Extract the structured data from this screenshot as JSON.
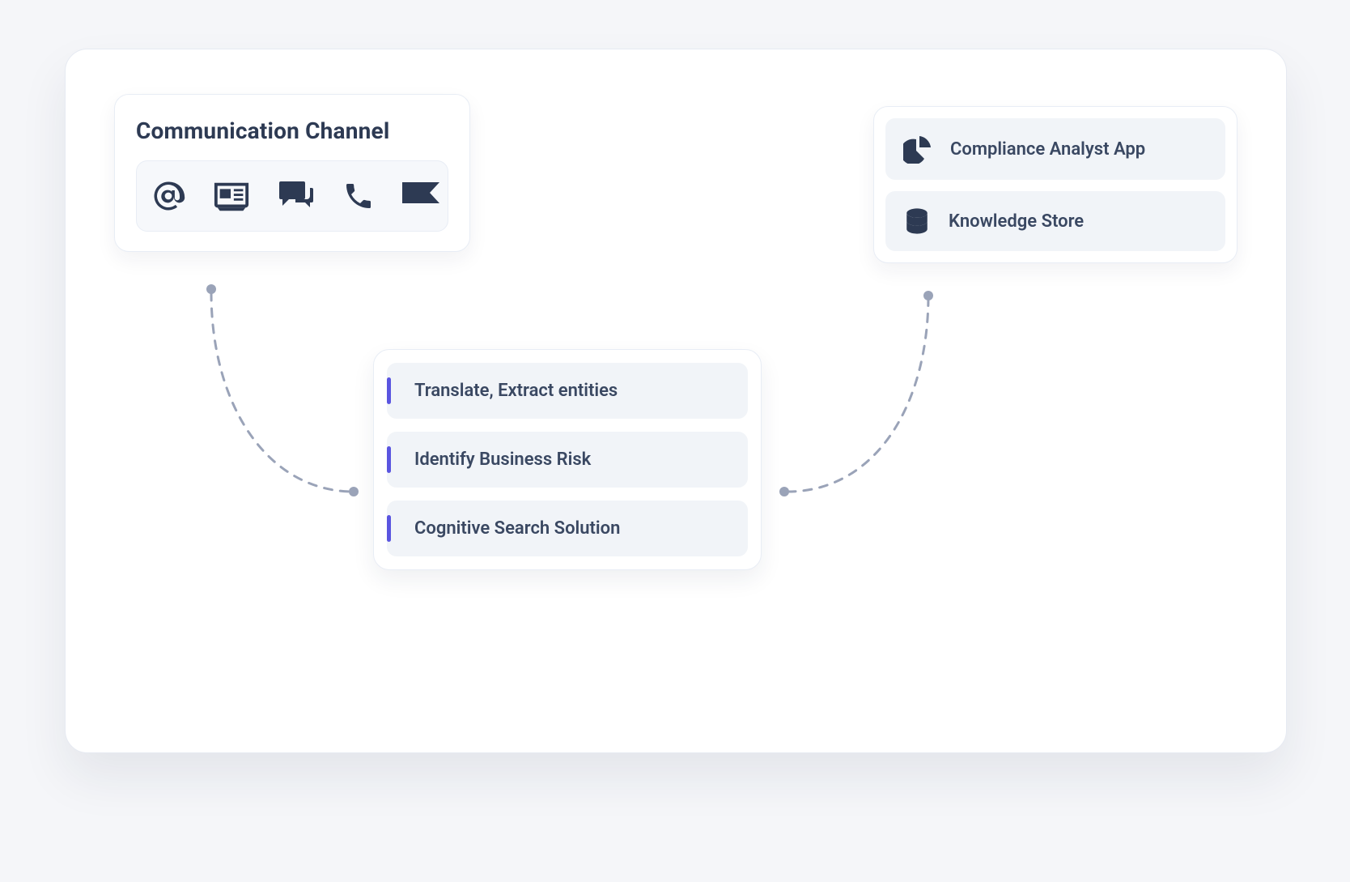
{
  "colors": {
    "text": "#2d3a53",
    "muted": "#3a4862",
    "accent": "#5a55e0",
    "panel": "#f1f4f8",
    "border": "#e8edf5"
  },
  "comm": {
    "title": "Communication Channel",
    "icons": [
      "at-icon",
      "newspaper-icon",
      "chat-icon",
      "phone-icon",
      "flag-icon"
    ]
  },
  "outputs": [
    {
      "icon": "pie-chart-icon",
      "label": "Compliance Analyst App"
    },
    {
      "icon": "database-icon",
      "label": "Knowledge Store"
    }
  ],
  "steps": [
    {
      "label": "Translate, Extract entities"
    },
    {
      "label": "Identify Business Risk"
    },
    {
      "label": "Cognitive Search Solution"
    }
  ]
}
